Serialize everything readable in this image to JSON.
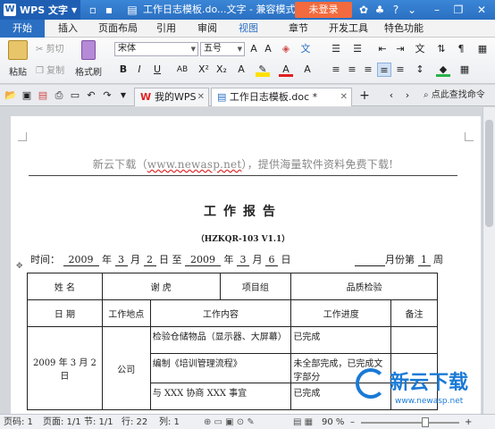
{
  "titlebar": {
    "app_name": "WPS 文字",
    "doc_title": "工作日志模板.do...文字 - 兼容模式",
    "login_label": "未登录"
  },
  "menu": {
    "tabs": [
      "开始",
      "插入",
      "页面布局",
      "引用",
      "审阅",
      "视图",
      "章节",
      "开发工具",
      "特色功能"
    ]
  },
  "ribbon": {
    "paste_label": "粘贴",
    "cut_label": "剪切",
    "copy_label": "复制",
    "format_painter_label": "格式刷",
    "font_name": "宋体",
    "font_size": "五号"
  },
  "doc_tabs": {
    "home_tab": "我的WPS",
    "active_tab": "工作日志模板.doc *",
    "search_label": "点此查找命令"
  },
  "document": {
    "header_prefix": "新云下载（",
    "header_url": "www.newasp.net",
    "header_suffix": "），提供海量软件资料免费下载!",
    "heading": "工作报告",
    "code": "（HZKQR-103  V1.1）",
    "date_line": {
      "label": "时间：",
      "from_year": "2009",
      "from_month": "3",
      "from_day": "2",
      "to_year": "2009",
      "to_month": "3",
      "to_day": "6",
      "year_unit": "年",
      "month_unit": "月",
      "day_unit": "日",
      "to_word": "至",
      "week_prefix": "月份第",
      "week_num": "1",
      "week_unit": "周"
    },
    "table": {
      "name_label": "姓  名",
      "name_value": "谢  虎",
      "group_label": "项目组",
      "group_value": "品质检验",
      "col_date": "日  期",
      "col_place": "工作地点",
      "col_content": "工作内容",
      "col_progress": "工作进度",
      "col_note": "备注",
      "date_value": "2009 年 3 月 2 日",
      "place_value": "公司",
      "rows": [
        {
          "content": "检验仓储物品（显示器、大屏幕）",
          "progress": "已完成"
        },
        {
          "content": "编制《培训管理流程》",
          "progress": "未全部完成，已完成文字部分"
        },
        {
          "content": "与 XXX 协商 XXX 事宜",
          "progress": "已完成"
        }
      ]
    }
  },
  "statusbar": {
    "page_num": "页码: 1",
    "pages": "页面: 1/1",
    "section": "节: 1/1",
    "row": "行: 22",
    "col": "列: 1",
    "zoom": "90 %"
  },
  "watermark": {
    "main": "新云下载",
    "sub": "www.newasp.net"
  }
}
